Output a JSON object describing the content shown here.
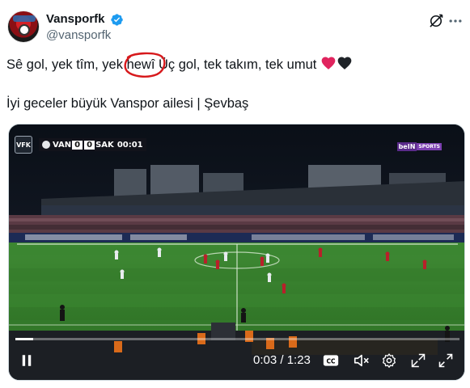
{
  "tweet": {
    "display_name": "Vansporfk",
    "handle": "@vansporfk",
    "text_line1_before": "Sê gol, yek tîm, yek ",
    "text_line1_circled": "hewî",
    "text_line1_after": " Üç gol, tek takım, tek umut ",
    "text_line2": "İyi geceler büyük Vanspor ailesi | Şevbaş"
  },
  "icons": {
    "verified": "verified-badge-icon",
    "grok": "grok-icon",
    "more": "more-options-icon",
    "hearts": [
      "red-heart-icon",
      "black-heart-icon"
    ]
  },
  "video": {
    "scorebug": {
      "club_logo": "VFK",
      "home": "VAN",
      "home_score": "0",
      "away_score": "0",
      "away": "SAK",
      "clock": "00:01"
    },
    "broadcaster": {
      "name": "beIN",
      "sub": "SPORTS"
    },
    "time_display": "0:03 / 1:23",
    "progress_fraction": 0.04,
    "controls": [
      "pause",
      "closed-captions",
      "mute",
      "settings",
      "fullscreen-popout",
      "fullscreen"
    ]
  },
  "colors": {
    "accent_blue": "#1d9bf0",
    "text_primary": "#0f1419",
    "text_secondary": "#536471",
    "heart_red": "#e0245e",
    "annotation_red": "#d7191c"
  }
}
